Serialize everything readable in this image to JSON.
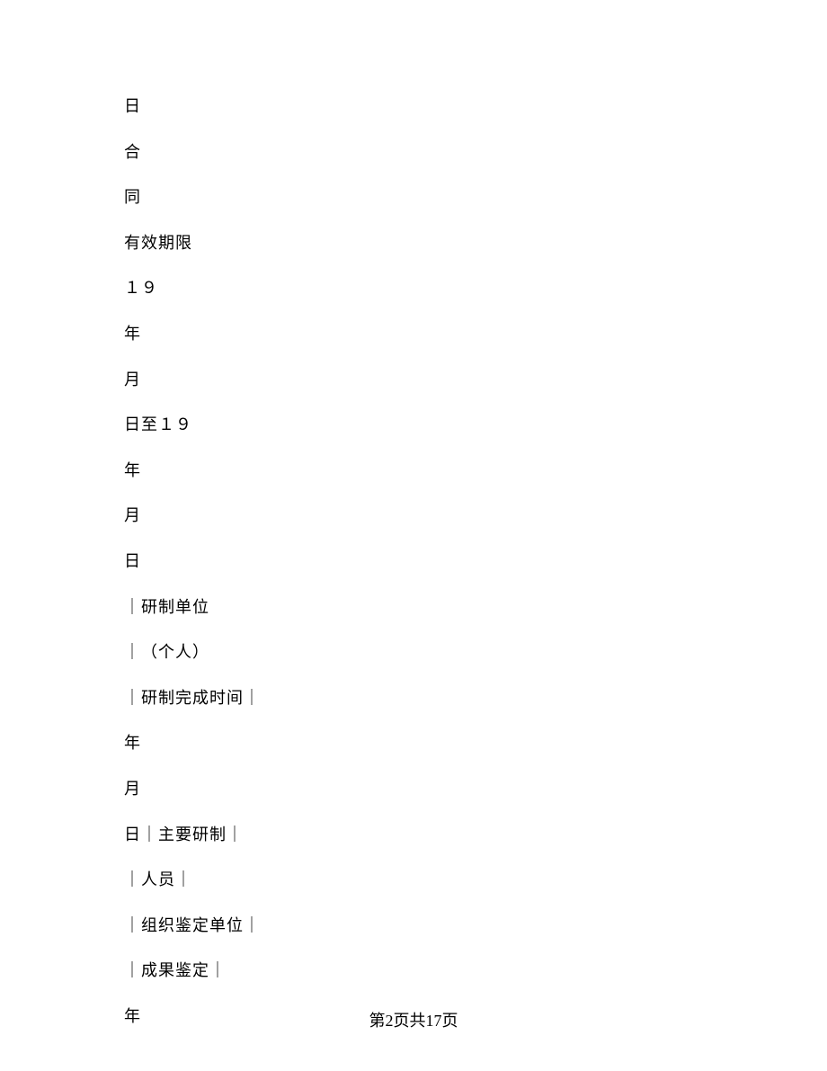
{
  "lines": [
    "日",
    "合",
    "同",
    "有效期限",
    "１９",
    "年",
    "月",
    "日至１９",
    "年",
    "月",
    "日",
    "｜研制单位",
    "｜（个人）",
    "｜研制完成时间｜",
    "年",
    "月",
    "日｜主要研制｜",
    "｜人员｜",
    "｜组织鉴定单位｜",
    "｜成果鉴定｜",
    "年"
  ],
  "footer": "第2页共17页"
}
